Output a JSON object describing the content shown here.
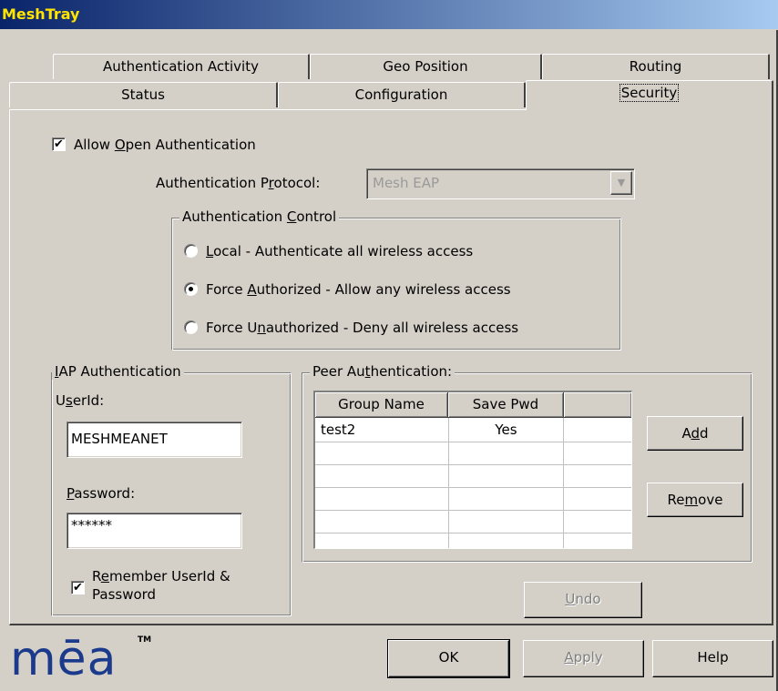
{
  "window": {
    "title": "MeshTray"
  },
  "tabs": {
    "row1": [
      "Authentication Activity",
      "Geo Position",
      "Routing"
    ],
    "row2": [
      "Status",
      "Configuration",
      "Security"
    ],
    "selected": "Security"
  },
  "security": {
    "allow_open_auth": {
      "pre": "Allow ",
      "u": "O",
      "post": "pen Authentication",
      "checked": true
    },
    "protocol": {
      "pre": "Authentication P",
      "u": "r",
      "post": "otocol:",
      "value": "Mesh EAP",
      "enabled": false
    },
    "auth_control": {
      "legend": {
        "pre": "Authentication ",
        "u": "C",
        "post": "ontrol"
      },
      "options": [
        {
          "pre": "",
          "u": "L",
          "post": "ocal - Authenticate all wireless access",
          "selected": false
        },
        {
          "pre": "Force ",
          "u": "A",
          "post": "uthorized - Allow any wireless access",
          "selected": true
        },
        {
          "pre": "Force U",
          "u": "n",
          "post": "authorized - Deny all wireless access",
          "selected": false
        }
      ]
    },
    "iap": {
      "legend": {
        "pre": "",
        "u": "I",
        "post": "AP Authentication"
      },
      "userid_label": {
        "pre": "U",
        "u": "s",
        "post": "erId:"
      },
      "userid_value": "MESHMEANET",
      "password_label": {
        "pre": "",
        "u": "P",
        "post": "assword:"
      },
      "password_value": "******",
      "remember": {
        "line1_pre": "R",
        "line1_u": "e",
        "line1_post": "member UserId &",
        "line2": "Password",
        "checked": true
      }
    },
    "peer": {
      "legend": {
        "pre": "Peer Au",
        "u": "t",
        "post": "hentication:"
      },
      "columns": [
        "Group Name",
        "Save Pwd",
        ""
      ],
      "rows": [
        [
          "test2",
          "Yes",
          ""
        ]
      ],
      "add_label": {
        "pre": "A",
        "u": "d",
        "post": "d"
      },
      "remove_label": {
        "pre": "Re",
        "u": "m",
        "post": "ove"
      }
    },
    "undo_label": {
      "pre": "",
      "u": "U",
      "post": "ndo",
      "enabled": false
    }
  },
  "footer": {
    "logo_text": "mēa",
    "logo_tm": "TM",
    "ok_label": "OK",
    "apply_label": {
      "pre": "",
      "u": "A",
      "post": "pply",
      "enabled": false
    },
    "help_label": "Help"
  },
  "colors": {
    "dialog_bg": "#d4d0c8",
    "title_text": "#ffe400",
    "title_bg_start": "#0a246a",
    "logo": "#1c3a8c",
    "disabled_text": "#808080"
  }
}
